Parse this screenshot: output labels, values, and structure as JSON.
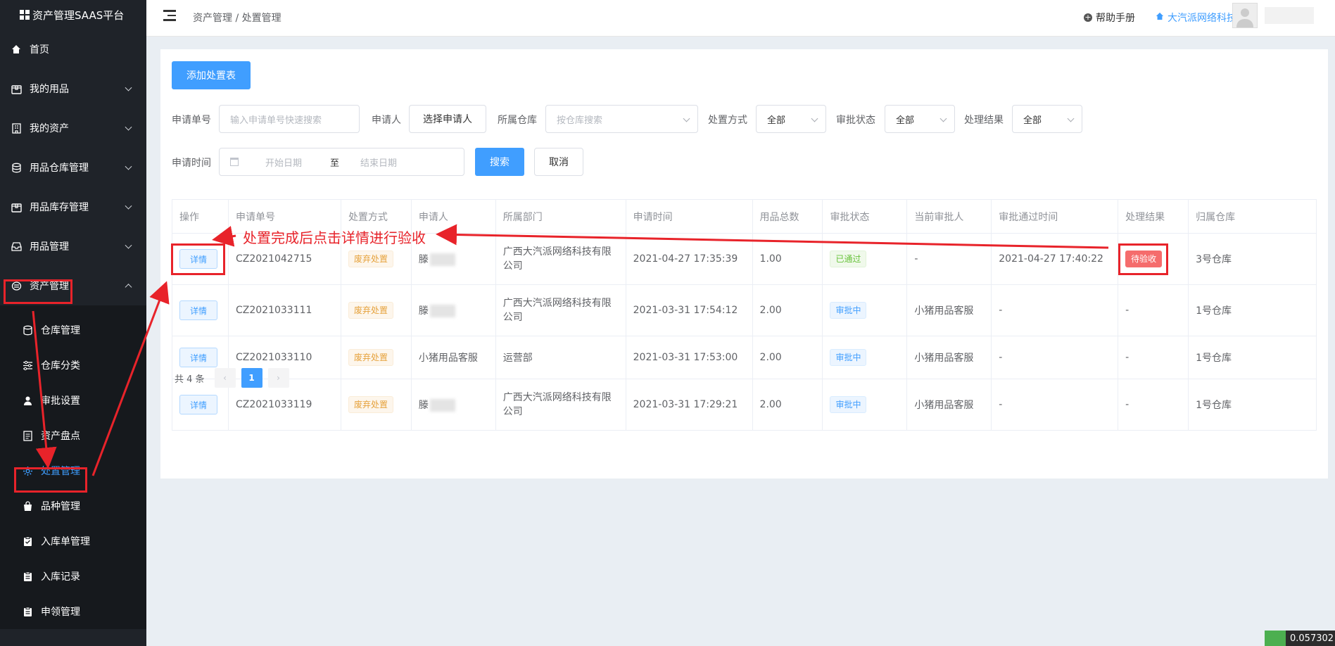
{
  "app": {
    "title": "资产管理SAAS平台"
  },
  "sidebar": {
    "items": [
      {
        "label": "首页",
        "icon": "home-icon"
      },
      {
        "label": "我的用品",
        "icon": "box-icon"
      },
      {
        "label": "我的资产",
        "icon": "building-icon"
      },
      {
        "label": "用品仓库管理",
        "icon": "database-icon"
      },
      {
        "label": "用品库存管理",
        "icon": "box-icon"
      },
      {
        "label": "用品管理",
        "icon": "inbox-icon"
      },
      {
        "label": "资产管理",
        "icon": "asset-icon"
      }
    ],
    "sub_items": [
      {
        "label": "仓库管理",
        "icon": "database-icon"
      },
      {
        "label": "仓库分类",
        "icon": "sliders-icon"
      },
      {
        "label": "审批设置",
        "icon": "user-icon"
      },
      {
        "label": "资产盘点",
        "icon": "document-icon"
      },
      {
        "label": "处置管理",
        "icon": "gear-icon"
      },
      {
        "label": "品种管理",
        "icon": "bag-icon"
      },
      {
        "label": "入库单管理",
        "icon": "clipboard-icon"
      },
      {
        "label": "入库记录",
        "icon": "clipboard-icon"
      },
      {
        "label": "申领管理",
        "icon": "clipboard-icon"
      }
    ]
  },
  "header": {
    "breadcrumb": "资产管理 / 处置管理",
    "help": "帮助手册",
    "company": "大汽派网络科技"
  },
  "toolbar": {
    "add_label": "添加处置表"
  },
  "filters": {
    "apply_no_label": "申请单号",
    "apply_no_placeholder": "输入申请单号快速搜索",
    "applicant_label": "申请人",
    "applicant_button": "选择申请人",
    "warehouse_label": "所属仓库",
    "warehouse_placeholder": "按仓库搜索",
    "method_label": "处置方式",
    "method_value": "全部",
    "approval_label": "审批状态",
    "approval_value": "全部",
    "result_label": "处理结果",
    "result_value": "全部",
    "time_label": "申请时间",
    "start_placeholder": "开始日期",
    "range_sep": "至",
    "end_placeholder": "结束日期",
    "search_label": "搜索",
    "cancel_label": "取消"
  },
  "table": {
    "headers": [
      "操作",
      "申请单号",
      "处置方式",
      "申请人",
      "所属部门",
      "申请时间",
      "用品总数",
      "审批状态",
      "当前审批人",
      "审批通过时间",
      "处理结果",
      "归属仓库"
    ],
    "rows": [
      {
        "action": "详情",
        "no": "CZ2021042715",
        "method": "废弃处置",
        "applicant": "滕",
        "dept": "广西大汽派网络科技有限公司",
        "time": "2021-04-27 17:35:39",
        "total": "1.00",
        "status": "已通过",
        "approver": "-",
        "pass_time": "2021-04-27 17:40:22",
        "result": "待验收",
        "warehouse": "3号仓库"
      },
      {
        "action": "详情",
        "no": "CZ2021033111",
        "method": "废弃处置",
        "applicant": "滕",
        "dept": "广西大汽派网络科技有限公司",
        "time": "2021-03-31 17:54:12",
        "total": "2.00",
        "status": "审批中",
        "approver": "小猪用品客服",
        "pass_time": "-",
        "result": "-",
        "warehouse": "1号仓库"
      },
      {
        "action": "详情",
        "no": "CZ2021033110",
        "method": "废弃处置",
        "applicant": "小猪用品客服",
        "dept": "运营部",
        "time": "2021-03-31 17:53:00",
        "total": "2.00",
        "status": "审批中",
        "approver": "小猪用品客服",
        "pass_time": "-",
        "result": "-",
        "warehouse": "1号仓库"
      },
      {
        "action": "详情",
        "no": "CZ2021033119",
        "method": "废弃处置",
        "applicant": "滕",
        "dept": "广西大汽派网络科技有限公司",
        "time": "2021-03-31 17:29:21",
        "total": "2.00",
        "status": "审批中",
        "approver": "小猪用品客服",
        "pass_time": "-",
        "result": "-",
        "warehouse": "1号仓库"
      }
    ]
  },
  "pagination": {
    "total_text": "共 4 条",
    "current": "1",
    "prev": "‹",
    "next": "›"
  },
  "annotation": "处置完成后点击详情进行验收",
  "corner_text": "0.057302",
  "colors": {
    "primary": "#409eff",
    "sidebar": "#1f2329",
    "annotation": "#e8232a"
  }
}
